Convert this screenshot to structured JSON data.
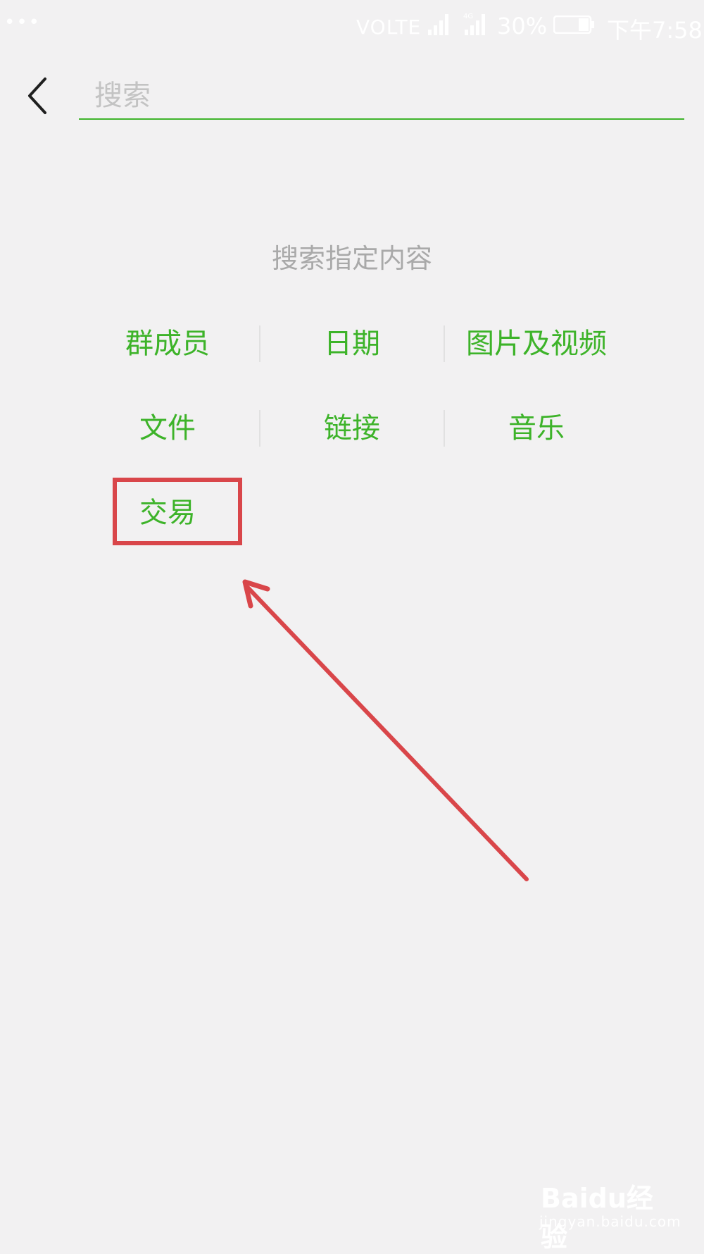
{
  "status_bar": {
    "dots": "•••",
    "volte": "VOLTE",
    "battery_percent": "30%",
    "time": "下午7:58"
  },
  "search": {
    "placeholder": "搜索"
  },
  "section_title": "搜索指定内容",
  "options": [
    {
      "label": "群成员"
    },
    {
      "label": "日期"
    },
    {
      "label": "图片及视频"
    },
    {
      "label": "文件"
    },
    {
      "label": "链接"
    },
    {
      "label": "音乐"
    },
    {
      "label": "交易"
    }
  ],
  "colors": {
    "accent": "#3db329",
    "annotation": "#d9464a",
    "background": "#f2f1f2"
  },
  "watermark": {
    "logo": "Baidu经验",
    "url": "jingyan.baidu.com"
  }
}
